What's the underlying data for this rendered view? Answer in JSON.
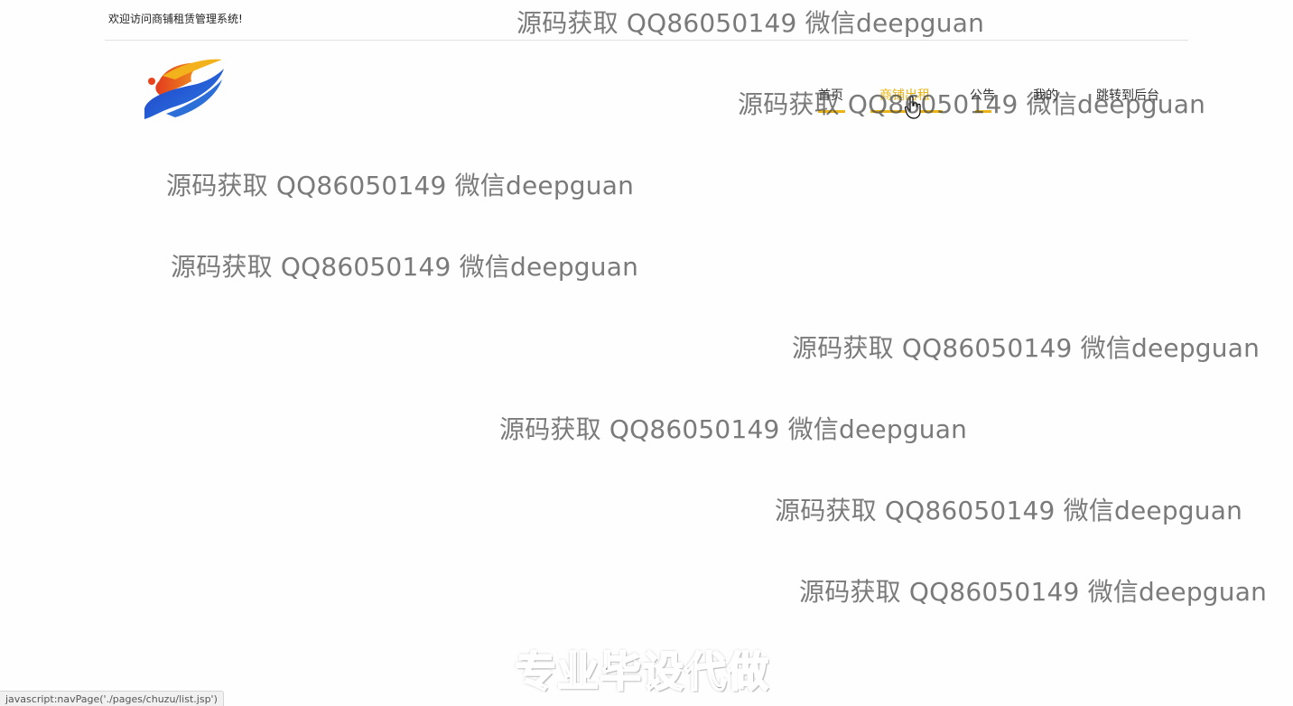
{
  "header": {
    "welcome": "欢迎访问商铺租赁管理系统!"
  },
  "nav": {
    "items": [
      {
        "label": "首页",
        "active": false
      },
      {
        "label": "商铺出租",
        "active": true
      },
      {
        "label": "公告",
        "active": false
      },
      {
        "label": "我的",
        "active": false
      },
      {
        "label": "跳转到后台",
        "active": false
      }
    ]
  },
  "watermarks": [
    "源码获取 QQ86050149 微信deepguan",
    "源码获取 QQ86050149 微信deepguan",
    "源码获取 QQ86050149 微信deepguan",
    "源码获取 QQ86050149 微信deepguan",
    "源码获取 QQ86050149 微信deepguan",
    "源码获取 QQ86050149 微信deepguan",
    "源码获取 QQ86050149 微信deepguan",
    "源码获取 QQ86050149 微信deepguan"
  ],
  "banner": "专业毕设代做",
  "status_bar": "javascript:navPage('./pages/chuzu/list.jsp')",
  "colors": {
    "accent": "#e8b417",
    "divider": "#e2e2e2"
  },
  "icons": {
    "logo": "swoosh-logo-icon",
    "cursor": "hand-pointer-icon"
  }
}
